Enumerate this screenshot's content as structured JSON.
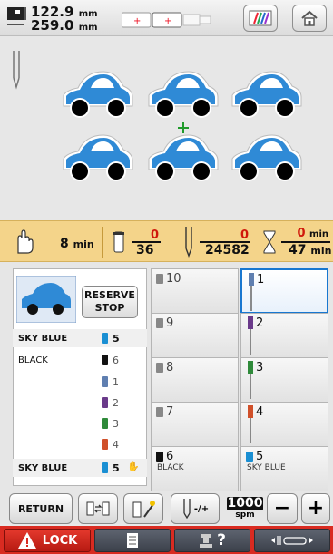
{
  "header": {
    "width_value": "122.9",
    "height_value": "259.0",
    "unit": "mm",
    "icons": [
      "embroidery-size-icon",
      "frame-indicator-icon",
      "color-palette-icon",
      "home-icon"
    ]
  },
  "canvas": {
    "design": "car",
    "design_count": 6,
    "colors": {
      "body": "#2f8ad6",
      "wheels": "#000000",
      "outline": "#ffffff"
    }
  },
  "status": {
    "time_to_stop": "8",
    "time_unit": "min",
    "color_current": "0",
    "color_total": "36",
    "stitch_current": "0",
    "stitch_total": "24582",
    "time_current": "0",
    "time_total": "47",
    "time_unit_right": "min"
  },
  "sequence": {
    "reserve_label_1": "RESERVE",
    "reserve_label_2": "STOP",
    "rows": [
      {
        "name": "SKY BLUE",
        "num": "5",
        "color": "#1a8fd3"
      },
      {
        "name": "BLACK",
        "num": "6",
        "color": "#111111"
      },
      {
        "name": "",
        "num": "1",
        "color": "#5f7fb0"
      },
      {
        "name": "",
        "num": "2",
        "color": "#6a3a8a"
      },
      {
        "name": "",
        "num": "3",
        "color": "#2f8a3a"
      },
      {
        "name": "",
        "num": "4",
        "color": "#d0502a"
      },
      {
        "name": "SKY BLUE",
        "num": "5",
        "color": "#1a8fd3"
      }
    ]
  },
  "needles": {
    "left": [
      {
        "num": "10",
        "label": ""
      },
      {
        "num": "9",
        "label": ""
      },
      {
        "num": "8",
        "label": ""
      },
      {
        "num": "7",
        "label": ""
      },
      {
        "num": "6",
        "label": "BLACK"
      }
    ],
    "right": [
      {
        "num": "1",
        "label": ""
      },
      {
        "num": "2",
        "label": ""
      },
      {
        "num": "3",
        "label": ""
      },
      {
        "num": "4",
        "label": ""
      },
      {
        "num": "5",
        "label": "SKY BLUE"
      }
    ]
  },
  "controls": {
    "return_label": "RETURN",
    "speed_value": "1000",
    "speed_unit": "spm",
    "minus": "−",
    "plus": "+",
    "needle_step_label": "-/+"
  },
  "footer": {
    "lock_label": "LOCK",
    "help_label": "?"
  }
}
